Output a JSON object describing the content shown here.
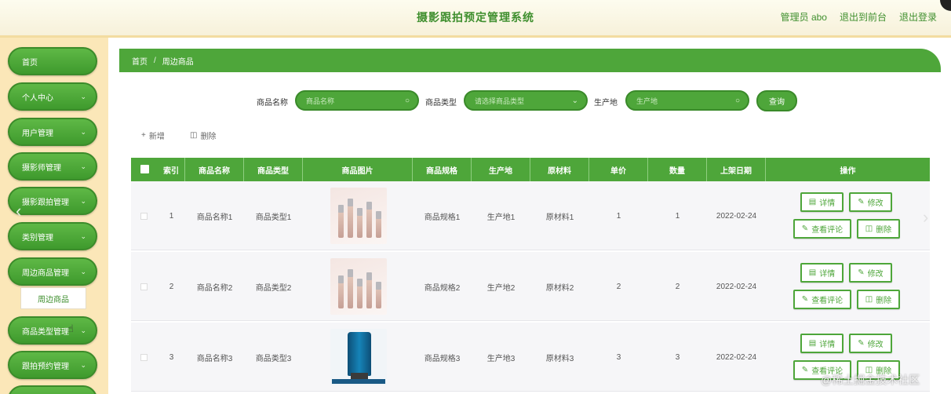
{
  "header": {
    "title": "摄影跟拍预定管理系统",
    "links": [
      "管理员 abo",
      "退出到前台",
      "退出登录"
    ]
  },
  "sidebar": {
    "items": [
      {
        "label": "首页",
        "has_chevron": false
      },
      {
        "label": "个人中心",
        "has_chevron": true
      },
      {
        "label": "用户管理",
        "has_chevron": true
      },
      {
        "label": "摄影师管理",
        "has_chevron": true
      },
      {
        "label": "摄影跟拍管理",
        "has_chevron": true
      },
      {
        "label": "类别管理",
        "has_chevron": true
      },
      {
        "label": "周边商品管理",
        "has_chevron": true
      },
      {
        "label": "商品类型管理",
        "has_chevron": true
      },
      {
        "label": "跟拍预约管理",
        "has_chevron": true
      }
    ],
    "submenu": {
      "label": "周边商品"
    }
  },
  "breadcrumb": {
    "home": "首页",
    "separator": "/",
    "current": "周边商品"
  },
  "search": {
    "name_label": "商品名称",
    "name_placeholder": "商品名称",
    "type_label": "商品类型",
    "type_placeholder": "请选择商品类型",
    "origin_label": "生产地",
    "origin_placeholder": "生产地",
    "button": "查询"
  },
  "toolbar": {
    "add": "新增",
    "delete": "删除"
  },
  "table": {
    "headers": [
      "索引",
      "商品名称",
      "商品类型",
      "商品图片",
      "商品规格",
      "生产地",
      "原材料",
      "单价",
      "数量",
      "上架日期",
      "操作"
    ],
    "rows": [
      {
        "index": "1",
        "name": "商品名称1",
        "type": "商品类型1",
        "image": "cosmetic-bottles",
        "spec": "商品规格1",
        "origin": "生产地1",
        "material": "原材料1",
        "price": "1",
        "qty": "1",
        "date": "2022-02-24"
      },
      {
        "index": "2",
        "name": "商品名称2",
        "type": "商品类型2",
        "image": "cosmetic-bottles",
        "spec": "商品规格2",
        "origin": "生产地2",
        "material": "原材料2",
        "price": "2",
        "qty": "2",
        "date": "2022-02-24"
      },
      {
        "index": "3",
        "name": "商品名称3",
        "type": "商品类型3",
        "image": "blue-tube",
        "spec": "商品规格3",
        "origin": "生产地3",
        "material": "原材料3",
        "price": "3",
        "qty": "3",
        "date": "2022-02-24"
      }
    ],
    "actions": {
      "detail": "详情",
      "edit": "修改",
      "comments": "查看评论",
      "delete": "删除"
    }
  },
  "watermark": "@稀土掘金技术社区",
  "colors": {
    "primary_green": "#4ea63a",
    "sidebar_bg": "#fbe7b8",
    "header_bg": "#fdfcef"
  }
}
